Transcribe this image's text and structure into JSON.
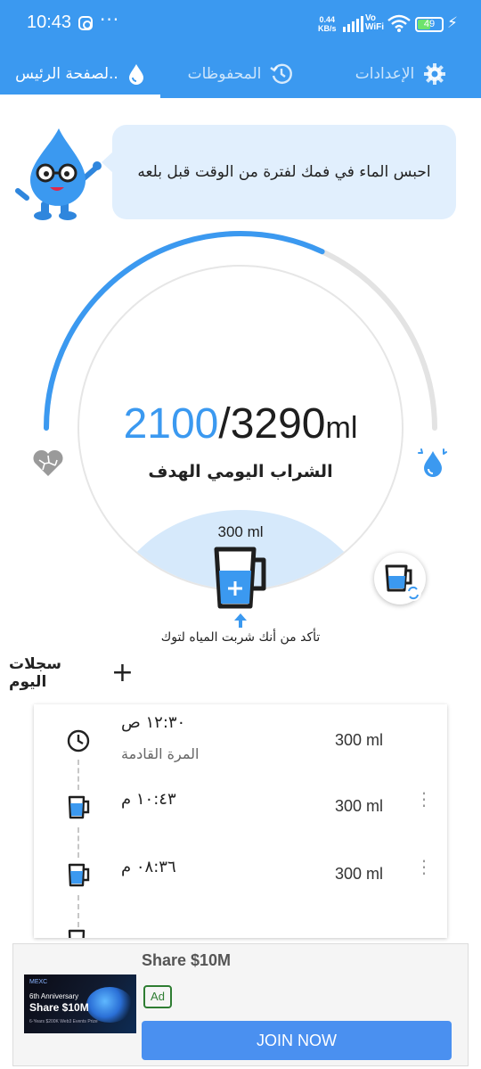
{
  "status_bar": {
    "time": "10:43",
    "more_dots": "···",
    "net_speed_value": "0.44",
    "net_speed_unit": "KB/s",
    "volte_line1": "Vo",
    "volte_line2": "WiFi",
    "battery": "49",
    "charging_glyph": "⚡"
  },
  "tabs": [
    {
      "label": "لصفحة الرئيس..",
      "icon": "water-drop-icon",
      "active": true
    },
    {
      "label": "المحفوظات",
      "icon": "history-icon",
      "active": false
    },
    {
      "label": "الإعدادات",
      "icon": "gear-icon",
      "active": false
    }
  ],
  "tip": {
    "text": "احبس الماء في فمك لفترة من الوقت قبل بلعه"
  },
  "progress": {
    "drunk": "2100",
    "separator": "/",
    "goal": "3290",
    "unit": "ml",
    "fraction": 0.638,
    "label": "الشراب اليومي الهدف"
  },
  "cup": {
    "amount": "300 ml",
    "plus": "+",
    "hint": "تأكد من أنك شربت المياه لتوك"
  },
  "records": {
    "title": "سجلات اليوم",
    "add": "+",
    "items": [
      {
        "time": "١٢:٣٠ ص",
        "sub": "المرة القادمة",
        "amount": "300 ml",
        "icon": "clock-icon",
        "more": false
      },
      {
        "time": "١٠:٤٣ م",
        "sub": "",
        "amount": "300 ml",
        "icon": "cup-icon",
        "more": true
      },
      {
        "time": "٠٨:٣٦ م",
        "sub": "",
        "amount": "300 ml",
        "icon": "cup-icon",
        "more": true
      }
    ]
  },
  "ad": {
    "title": "Share $10M",
    "badge": "Ad",
    "cta": "JOIN NOW",
    "image_brand": "MEXC",
    "image_line1": "6th Anniversary",
    "image_line2": "Share $10M",
    "image_fine": "6-Years  $200K Web3 Events Prize"
  },
  "colors": {
    "primary": "#3b99f0",
    "track": "#e3e3e3",
    "bubble": "#e1effd",
    "cta": "#4a90f0"
  }
}
